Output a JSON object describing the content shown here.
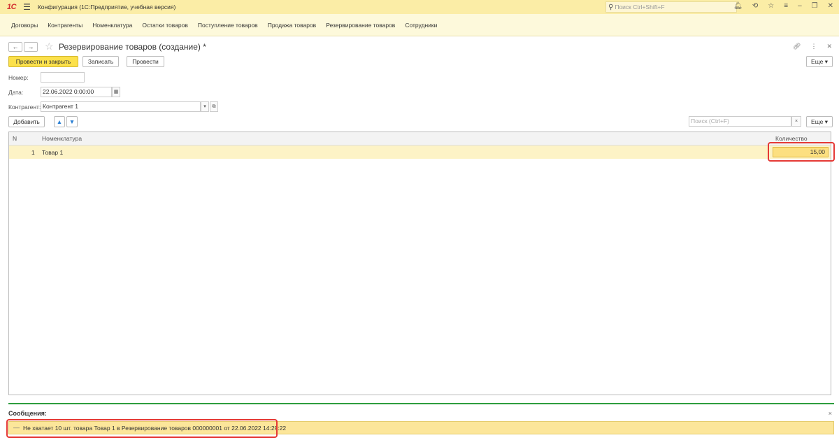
{
  "titlebar": {
    "logo": "1С",
    "menu_icon": "hamburger-icon",
    "title": "Конфигурация  (1С:Предприятие, учебная версия)",
    "search_placeholder": "Поиск Ctrl+Shift+F",
    "icons": [
      "bell-icon",
      "history-icon",
      "star-icon",
      "settings-icon",
      "minimize-icon",
      "restore-icon",
      "close-icon"
    ]
  },
  "sections": [
    "Договоры",
    "Контрагенты",
    "Номенклатура",
    "Остатки товаров",
    "Поступление товаров",
    "Продажа товаров",
    "Резервирование товаров",
    "Сотрудники"
  ],
  "form": {
    "back": "←",
    "forward": "→",
    "title": "Резервирование товаров (создание) *",
    "post_close_label": "Провести и закрыть",
    "write_label": "Записать",
    "post_label": "Провести",
    "more_label": "Еще",
    "number_label": "Номер:",
    "number_value": "",
    "date_label": "Дата:",
    "date_value": "22.06.2022  0:00:00",
    "counterparty_label": "Контрагент:",
    "counterparty_value": "Контрагент 1"
  },
  "table_toolbar": {
    "add_label": "Добавить",
    "search_placeholder": "Поиск (Ctrl+F)",
    "clear": "×",
    "more_label": "Еще"
  },
  "table": {
    "columns": [
      "N",
      "Номенклатура",
      "Количество"
    ],
    "rows": [
      {
        "n": "1",
        "item": "Товар 1",
        "qty": "15,00"
      }
    ]
  },
  "messages": {
    "title": "Сообщения:",
    "close": "×",
    "items": [
      "Не хватает 10 шт. товара Товар 1 в Резервирование товаров 000000001 от 22.06.2022 14:29:22"
    ]
  },
  "colors": {
    "titlebar_bg": "#fbeda6",
    "primary_button": "#fce14b",
    "highlight": "#e53935",
    "messages_line": "#2e9e3e"
  }
}
